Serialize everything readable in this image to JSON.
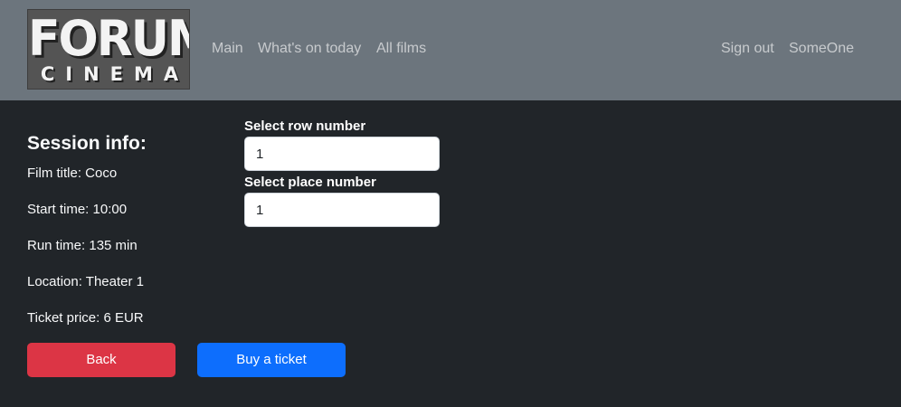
{
  "logo": {
    "line1": "FORUM",
    "line2": "CINEMA"
  },
  "nav": {
    "main": "Main",
    "whats_on_today": "What's on today",
    "all_films": "All films",
    "sign_out": "Sign out",
    "user": "SomeOne"
  },
  "session": {
    "title": "Session info:",
    "film_title": "Film title: Coco",
    "start_time": "Start time: 10:00",
    "run_time": "Run time: 135 min",
    "location": "Location: Theater 1",
    "ticket_price": "Ticket price: 6 EUR"
  },
  "form": {
    "row_label": "Select row number",
    "row_value": "1",
    "place_label": "Select place number",
    "place_value": "1"
  },
  "buttons": {
    "back": "Back",
    "buy": "Buy a ticket"
  },
  "colors": {
    "navbar": "#6c757d",
    "background": "#212529",
    "danger": "#dc3545",
    "primary": "#0d6efd"
  }
}
